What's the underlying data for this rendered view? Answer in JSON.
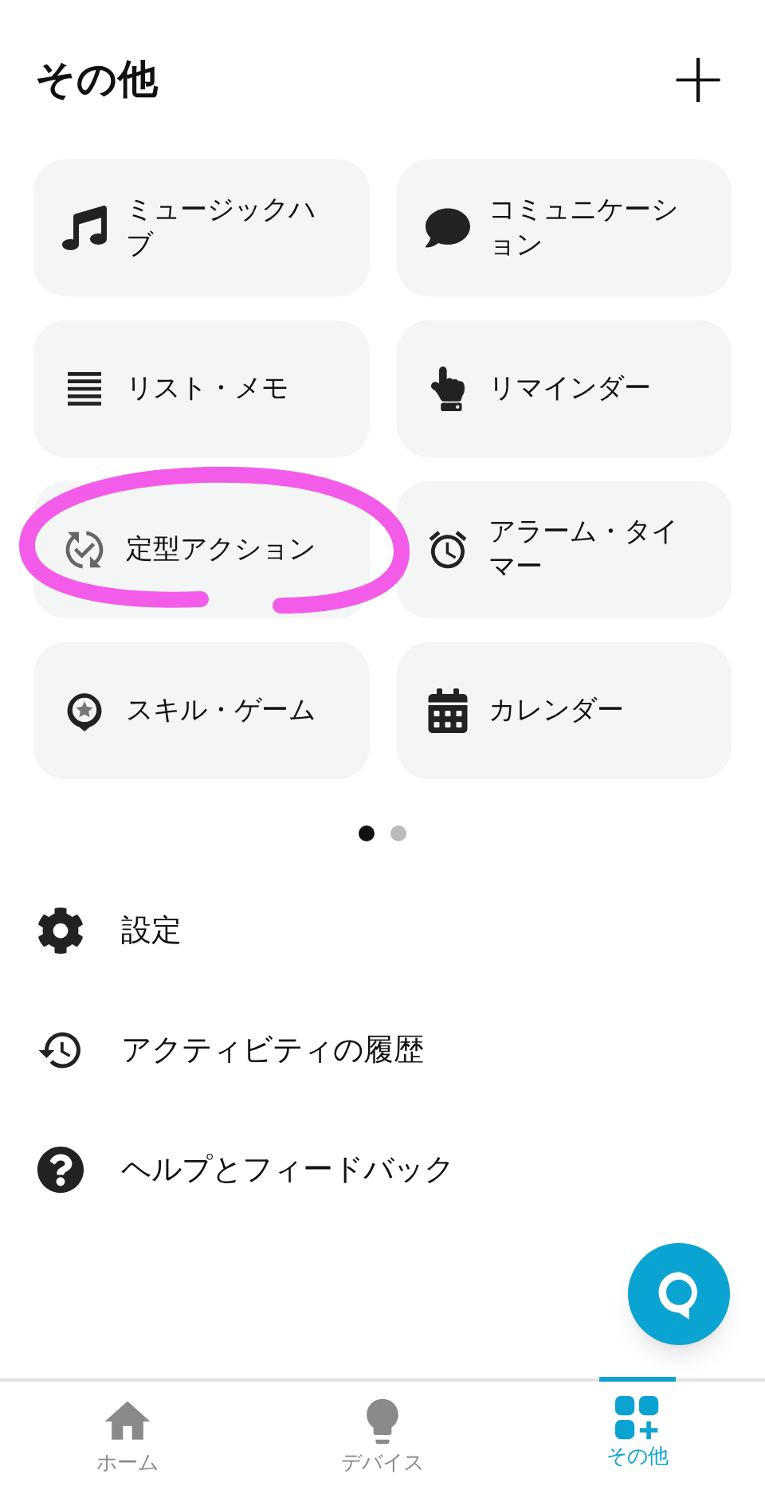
{
  "header": {
    "title": "その他",
    "add_label": "+"
  },
  "tiles": [
    {
      "label": "ミュージックハブ"
    },
    {
      "label": "コミュニケーション"
    },
    {
      "label": "リスト・メモ"
    },
    {
      "label": "リマインダー"
    },
    {
      "label": "定型アクション"
    },
    {
      "label": "アラーム・タイマー"
    },
    {
      "label": "スキル・ゲーム"
    },
    {
      "label": "カレンダー"
    }
  ],
  "pages": [
    {
      "selected": true
    },
    {
      "selected": false
    }
  ],
  "menu": [
    {
      "label": "設定"
    },
    {
      "label": "アクティビティの履歴"
    },
    {
      "label": "ヘルプとフィードバック"
    }
  ],
  "tabs": [
    {
      "label": "ホーム",
      "selected": false
    },
    {
      "label": "デバイス",
      "selected": false
    },
    {
      "label": "その他",
      "selected": true
    }
  ]
}
